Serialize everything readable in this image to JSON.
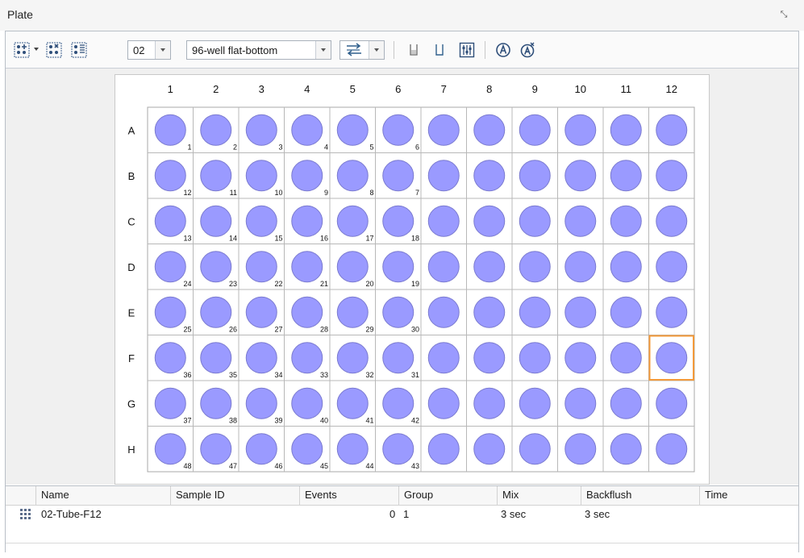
{
  "panel": {
    "title": "Plate",
    "close_glyph": "⤡"
  },
  "toolbar": {
    "icons": [
      "add-wells-icon",
      "add-wells-dropdown-icon",
      "remove-wells-icon",
      "well-order-icon",
      "direction-icon",
      "direction-dropdown-icon",
      "tube-icon",
      "open-tube-icon",
      "settings-grid-icon",
      "auto-icon",
      "auto-clear-icon"
    ],
    "plate_number": "02",
    "plate_type": "96-well flat-bottom"
  },
  "plate": {
    "columns": [
      "1",
      "2",
      "3",
      "4",
      "5",
      "6",
      "7",
      "8",
      "9",
      "10",
      "11",
      "12"
    ],
    "rows": [
      "A",
      "B",
      "C",
      "D",
      "E",
      "F",
      "G",
      "H"
    ],
    "well_color": "#9a9aff",
    "well_stroke": "#7a7acf",
    "selected_well": "F12",
    "selected_color": "#f39a3a",
    "well_numbers": [
      [
        "1",
        "2",
        "3",
        "4",
        "5",
        "6"
      ],
      [
        "12",
        "11",
        "10",
        "9",
        "8",
        "7"
      ],
      [
        "13",
        "14",
        "15",
        "16",
        "17",
        "18"
      ],
      [
        "24",
        "23",
        "22",
        "21",
        "20",
        "19"
      ],
      [
        "25",
        "26",
        "27",
        "28",
        "29",
        "30"
      ],
      [
        "36",
        "35",
        "34",
        "33",
        "32",
        "31"
      ],
      [
        "37",
        "38",
        "39",
        "40",
        "41",
        "42"
      ],
      [
        "48",
        "47",
        "46",
        "45",
        "44",
        "43"
      ]
    ]
  },
  "table": {
    "headers": [
      "Name",
      "Sample ID",
      "Events",
      "Group",
      "Mix",
      "Backflush",
      "Time"
    ],
    "rows": [
      {
        "name": "02-Tube-F12",
        "sample_id": "",
        "events": "0",
        "group": "1",
        "mix": "3 sec",
        "backflush": "3 sec",
        "time": ""
      }
    ]
  }
}
